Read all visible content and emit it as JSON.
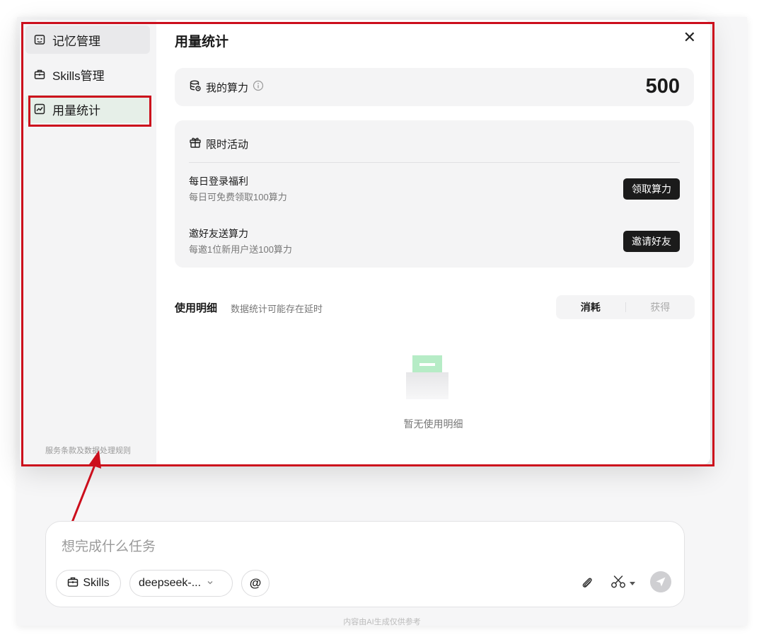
{
  "sidebar": {
    "items": [
      {
        "label": "记忆管理",
        "icon": "memory-icon"
      },
      {
        "label": "Skills管理",
        "icon": "toolbox-icon"
      },
      {
        "label": "用量统计",
        "icon": "chart-icon"
      }
    ],
    "footer": "服务条款及数据处理规则"
  },
  "header": {
    "title": "用量统计",
    "close": "✕"
  },
  "power": {
    "label": "我的算力",
    "value": "500"
  },
  "promo": {
    "title": "限时活动",
    "items": [
      {
        "title": "每日登录福利",
        "desc": "每日可免费领取100算力",
        "button": "领取算力"
      },
      {
        "title": "邀好友送算力",
        "desc": "每邀1位新用户送100算力",
        "button": "邀请好友"
      }
    ]
  },
  "details": {
    "title": "使用明细",
    "subtitle": "数据统计可能存在延时",
    "tabs": [
      {
        "label": "消耗",
        "selected": true
      },
      {
        "label": "获得",
        "selected": false
      }
    ],
    "empty_text": "暂无使用明细"
  },
  "composer": {
    "placeholder": "想完成什么任务",
    "skills_label": "Skills",
    "model_label": "deepseek-...",
    "at_label": "@"
  },
  "footer_note": "内容由AI生成仅供参考",
  "colors": {
    "annotation_red": "#cc0e1c",
    "active_bg": "#e6efe8",
    "button_dark": "#1b1b1b",
    "empty_green": "#b6ecc6"
  }
}
